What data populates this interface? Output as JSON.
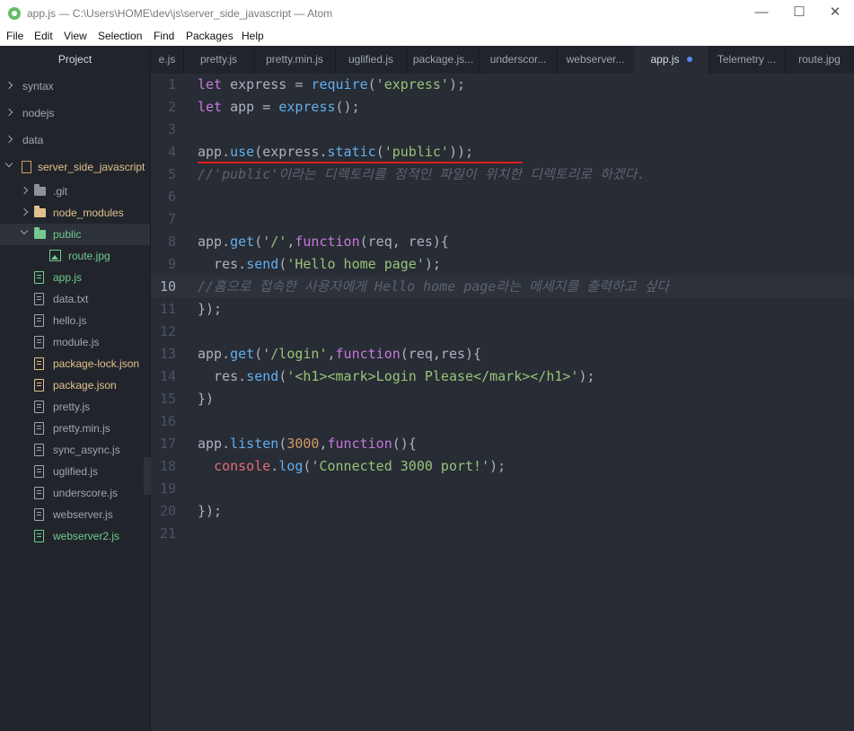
{
  "window": {
    "title": "app.js — C:\\Users\\HOME\\dev\\js\\server_side_javascript — Atom",
    "minimize": "—",
    "maximize": "☐",
    "close": "✕"
  },
  "menu": [
    "File",
    "Edit",
    "View",
    "Selection",
    "Find",
    "Packages",
    "Help"
  ],
  "sidebar": {
    "title": "Project",
    "items": [
      {
        "label": "syntax",
        "kind": "folder",
        "depth": 0,
        "state": "collapsed"
      },
      {
        "label": "nodejs",
        "kind": "folder",
        "depth": 0,
        "state": "collapsed"
      },
      {
        "label": "data",
        "kind": "folder",
        "depth": 0,
        "state": "collapsed"
      },
      {
        "label": "server_side_javascript",
        "kind": "repo",
        "depth": 0,
        "state": "expanded"
      },
      {
        "label": ".git",
        "kind": "folder",
        "depth": 1,
        "state": "collapsed"
      },
      {
        "label": "node_modules",
        "kind": "folder",
        "depth": 1,
        "state": "collapsed"
      },
      {
        "label": "public",
        "kind": "folder",
        "depth": 1,
        "state": "expanded"
      },
      {
        "label": "route.jpg",
        "kind": "image",
        "depth": 2
      },
      {
        "label": "app.js",
        "kind": "file",
        "depth": 1,
        "status": "added"
      },
      {
        "label": "data.txt",
        "kind": "file",
        "depth": 1
      },
      {
        "label": "hello.js",
        "kind": "file",
        "depth": 1
      },
      {
        "label": "module.js",
        "kind": "file",
        "depth": 1
      },
      {
        "label": "package-lock.json",
        "kind": "file",
        "depth": 1,
        "status": "modified"
      },
      {
        "label": "package.json",
        "kind": "file",
        "depth": 1,
        "status": "modified"
      },
      {
        "label": "pretty.js",
        "kind": "file",
        "depth": 1
      },
      {
        "label": "pretty.min.js",
        "kind": "file",
        "depth": 1
      },
      {
        "label": "sync_async.js",
        "kind": "file",
        "depth": 1
      },
      {
        "label": "uglified.js",
        "kind": "file",
        "depth": 1
      },
      {
        "label": "underscore.js",
        "kind": "file",
        "depth": 1
      },
      {
        "label": "webserver.js",
        "kind": "file",
        "depth": 1
      },
      {
        "label": "webserver2.js",
        "kind": "file",
        "depth": 1,
        "status": "added"
      }
    ],
    "collapse_glyph": "‹"
  },
  "tabs": [
    "e.js",
    "pretty.js",
    "pretty.min.js",
    "uglified.js",
    "package.js...",
    "underscor...",
    "webserver...",
    "app.js",
    "Telemetry ...",
    "route.jpg"
  ],
  "active_tab": 7,
  "colors": {
    "added": "#73c990",
    "modified": "#e2c08d",
    "accent": "#568af2",
    "annotation": "#e21d1d"
  },
  "editor": {
    "cursor_line": 10,
    "lines": [
      [
        [
          "k",
          "let"
        ],
        [
          "p",
          " express = "
        ],
        [
          "f",
          "require"
        ],
        [
          "p",
          "("
        ],
        [
          "s",
          "'express'"
        ],
        [
          "p",
          ");"
        ]
      ],
      [
        [
          "k",
          "let"
        ],
        [
          "p",
          " app = "
        ],
        [
          "f",
          "express"
        ],
        [
          "p",
          "();"
        ]
      ],
      [],
      [
        [
          "p",
          "app."
        ],
        [
          "f",
          "use"
        ],
        [
          "p",
          "(express."
        ],
        [
          "f",
          "static"
        ],
        [
          "p",
          "("
        ],
        [
          "s",
          "'public'"
        ],
        [
          "p",
          "));"
        ]
      ],
      [
        [
          "c",
          "//'public'이라는 디렉토리를 정적인 파일이 위치한 디렉토리로 하겠다."
        ]
      ],
      [],
      [],
      [
        [
          "p",
          "app."
        ],
        [
          "f",
          "get"
        ],
        [
          "p",
          "("
        ],
        [
          "s",
          "'/'"
        ],
        [
          "p",
          ","
        ],
        [
          "k",
          "function"
        ],
        [
          "p",
          "(req, res){"
        ]
      ],
      [
        [
          "p",
          "  res."
        ],
        [
          "f",
          "send"
        ],
        [
          "p",
          "("
        ],
        [
          "s",
          "'Hello home page'"
        ],
        [
          "p",
          ");"
        ]
      ],
      [
        [
          "c",
          "//홈으로 접속한 사용자에게 Hello home page라는 메세지를 출력하고 싶다"
        ]
      ],
      [
        [
          "p",
          "});"
        ]
      ],
      [],
      [
        [
          "p",
          "app."
        ],
        [
          "f",
          "get"
        ],
        [
          "p",
          "("
        ],
        [
          "s",
          "'/login'"
        ],
        [
          "p",
          ","
        ],
        [
          "k",
          "function"
        ],
        [
          "p",
          "(req,res){"
        ]
      ],
      [
        [
          "p",
          "  res."
        ],
        [
          "f",
          "send"
        ],
        [
          "p",
          "("
        ],
        [
          "s",
          "'<h1><mark>Login Please</mark></h1>'"
        ],
        [
          "p",
          ");"
        ]
      ],
      [
        [
          "p",
          "})"
        ]
      ],
      [],
      [
        [
          "p",
          "app."
        ],
        [
          "f",
          "listen"
        ],
        [
          "p",
          "("
        ],
        [
          "n",
          "3000"
        ],
        [
          "p",
          ","
        ],
        [
          "k",
          "function"
        ],
        [
          "p",
          "(){"
        ]
      ],
      [
        [
          "p",
          "  "
        ],
        [
          "v",
          "console"
        ],
        [
          "p",
          "."
        ],
        [
          "f",
          "log"
        ],
        [
          "p",
          "("
        ],
        [
          "s",
          "'Connected 3000 port!'"
        ],
        [
          "p",
          ");"
        ]
      ],
      [],
      [
        [
          "p",
          "});"
        ]
      ],
      []
    ]
  }
}
